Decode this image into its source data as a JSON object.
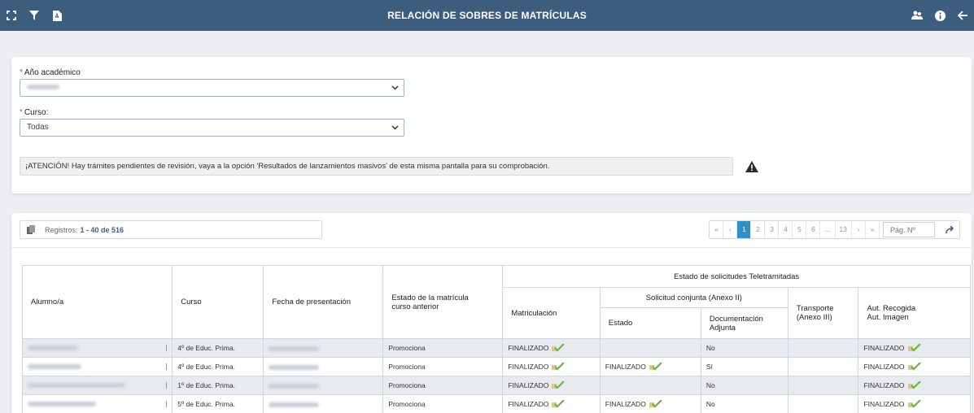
{
  "header": {
    "title": "RELACIÓN DE SOBRES DE MATRÍCULAS",
    "left_icons": [
      "expand-icon",
      "filter-icon",
      "pdf-icon"
    ],
    "right_icons": [
      "users-icon",
      "info-icon",
      "back-arrow-icon"
    ]
  },
  "form": {
    "year_label": "Año académico",
    "year_value": "",
    "course_label": "Curso:",
    "course_value": "Todas",
    "required_mark": "*",
    "alert_text": "¡ATENCIÓN! Hay trámites pendientes de revisión, vaya a la opción 'Resultados de lanzamientos masivos' de esta misma pantalla para su comprobación."
  },
  "records": {
    "prefix": "Registros:",
    "range": "1 - 40 de 516"
  },
  "pager": {
    "first": "«",
    "prev": "‹",
    "pages": [
      "1",
      "2",
      "3",
      "4",
      "5",
      "6",
      "...",
      "13"
    ],
    "active_page": "1",
    "next": "›",
    "last": "»",
    "page_placeholder": "Pág. Nº"
  },
  "table": {
    "headers": {
      "alumno": "Alumno/a",
      "curso": "Curso",
      "fecha": "Fecha de presentación",
      "estado_anterior": "Estado de la matrícula curso anterior",
      "group": "Estado de solicitudes Teletramitadas",
      "matriculacion": "Matriculación",
      "solicitud": "Solicitud conjunta (Anexo II)",
      "estado": "Estado",
      "documentacion": "Documentación Adjunta",
      "transporte": "Transporte (Anexo III)",
      "aut": "Aut. Recogida Aut. Imagen"
    },
    "rows": [
      {
        "curso": "4º de Educ. Prima.",
        "estado_anterior": "Promociona",
        "matriculacion": "FINALIZADO",
        "estado": "",
        "documentacion": "No",
        "transporte": "",
        "aut": "FINALIZADO"
      },
      {
        "curso": "4º de Educ. Prima.",
        "estado_anterior": "Promociona",
        "matriculacion": "FINALIZADO",
        "estado": "FINALIZADO",
        "documentacion": "Sí",
        "transporte": "",
        "aut": "FINALIZADO"
      },
      {
        "curso": "1º de Educ. Prima.",
        "estado_anterior": "Promociona",
        "matriculacion": "FINALIZADO",
        "estado": "",
        "documentacion": "No",
        "transporte": "",
        "aut": "FINALIZADO"
      },
      {
        "curso": "5º de Educ. Prima.",
        "estado_anterior": "Promociona",
        "matriculacion": "FINALIZADO",
        "estado": "FINALIZADO",
        "documentacion": "No",
        "transporte": "",
        "aut": "FINALIZADO"
      }
    ]
  }
}
